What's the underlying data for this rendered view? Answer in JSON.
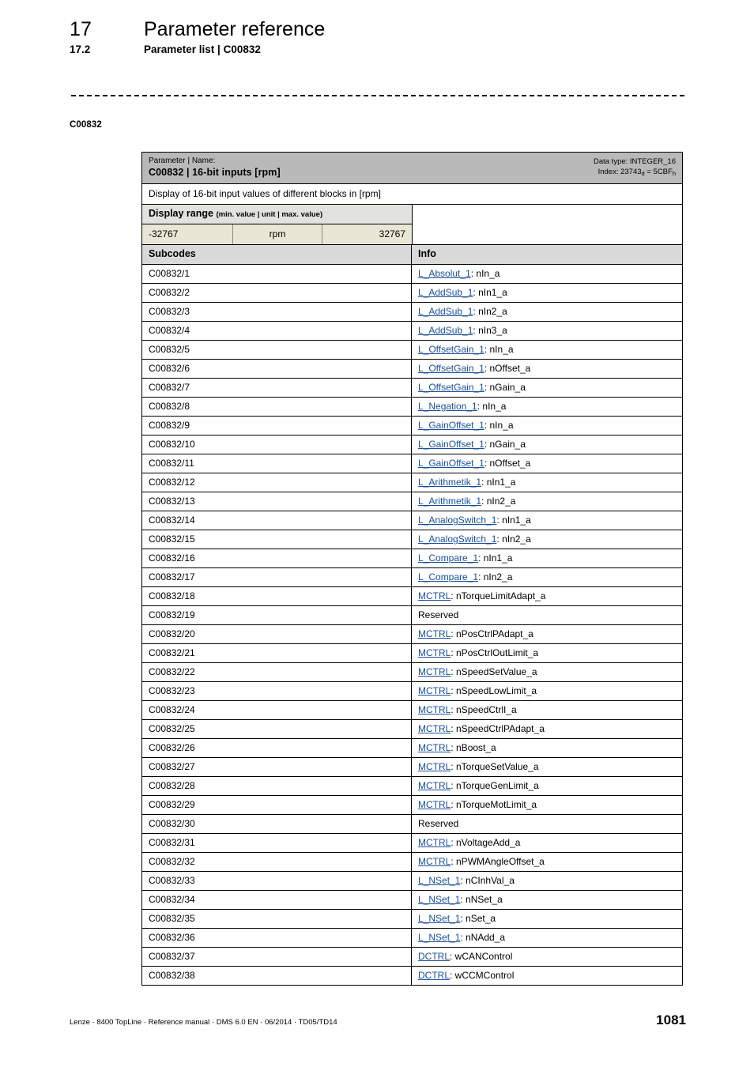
{
  "header": {
    "chapter_number": "17",
    "chapter_title": "Parameter reference",
    "section_number": "17.2",
    "section_title": "Parameter list | C00832"
  },
  "margin_label": "C00832",
  "parameter": {
    "kicker": "Parameter | Name:",
    "name": "C00832 | 16-bit inputs [rpm]",
    "data_type_label": "Data type: INTEGER_16",
    "index_prefix": "Index: 23743",
    "index_dec_sub": "d",
    "index_equals": " = 5CBF",
    "index_hex_sub": "h",
    "description": "Display of 16-bit input values of different blocks in [rpm]",
    "display_range": {
      "title": "Display range ",
      "note": "(min. value | unit | max. value)",
      "min": "-32767",
      "unit": "rpm",
      "max": "32767"
    },
    "columns": {
      "subcodes": "Subcodes",
      "info": "Info"
    },
    "rows": [
      {
        "subcode": "C00832/1",
        "link": "L_Absolut_1",
        "signal": ": nIn_a"
      },
      {
        "subcode": "C00832/2",
        "link": "L_AddSub_1",
        "signal": ": nIn1_a"
      },
      {
        "subcode": "C00832/3",
        "link": "L_AddSub_1",
        "signal": ": nIn2_a"
      },
      {
        "subcode": "C00832/4",
        "link": "L_AddSub_1",
        "signal": ": nIn3_a"
      },
      {
        "subcode": "C00832/5",
        "link": "L_OffsetGain_1",
        "signal": ": nIn_a"
      },
      {
        "subcode": "C00832/6",
        "link": "L_OffsetGain_1",
        "signal": ": nOffset_a"
      },
      {
        "subcode": "C00832/7",
        "link": "L_OffsetGain_1",
        "signal": ": nGain_a"
      },
      {
        "subcode": "C00832/8",
        "link": "L_Negation_1",
        "signal": ": nIn_a"
      },
      {
        "subcode": "C00832/9",
        "link": "L_GainOffset_1",
        "signal": ": nIn_a"
      },
      {
        "subcode": "C00832/10",
        "link": "L_GainOffset_1",
        "signal": ": nGain_a"
      },
      {
        "subcode": "C00832/11",
        "link": "L_GainOffset_1",
        "signal": ": nOffset_a"
      },
      {
        "subcode": "C00832/12",
        "link": "L_Arithmetik_1",
        "signal": ": nIn1_a"
      },
      {
        "subcode": "C00832/13",
        "link": "L_Arithmetik_1",
        "signal": ": nIn2_a"
      },
      {
        "subcode": "C00832/14",
        "link": "L_AnalogSwitch_1",
        "signal": ": nIn1_a"
      },
      {
        "subcode": "C00832/15",
        "link": "L_AnalogSwitch_1",
        "signal": ": nIn2_a"
      },
      {
        "subcode": "C00832/16",
        "link": "L_Compare_1",
        "signal": ": nIn1_a"
      },
      {
        "subcode": "C00832/17",
        "link": "L_Compare_1",
        "signal": ": nIn2_a"
      },
      {
        "subcode": "C00832/18",
        "link": "MCTRL",
        "signal": ": nTorqueLimitAdapt_a"
      },
      {
        "subcode": "C00832/19",
        "link": "",
        "signal": "Reserved"
      },
      {
        "subcode": "C00832/20",
        "link": "MCTRL",
        "signal": ": nPosCtrlPAdapt_a"
      },
      {
        "subcode": "C00832/21",
        "link": "MCTRL",
        "signal": ": nPosCtrlOutLimit_a"
      },
      {
        "subcode": "C00832/22",
        "link": "MCTRL",
        "signal": ": nSpeedSetValue_a"
      },
      {
        "subcode": "C00832/23",
        "link": "MCTRL",
        "signal": ": nSpeedLowLimit_a"
      },
      {
        "subcode": "C00832/24",
        "link": "MCTRL",
        "signal": ": nSpeedCtrlI_a"
      },
      {
        "subcode": "C00832/25",
        "link": "MCTRL",
        "signal": ": nSpeedCtrlPAdapt_a"
      },
      {
        "subcode": "C00832/26",
        "link": "MCTRL",
        "signal": ": nBoost_a"
      },
      {
        "subcode": "C00832/27",
        "link": "MCTRL",
        "signal": ": nTorqueSetValue_a"
      },
      {
        "subcode": "C00832/28",
        "link": "MCTRL",
        "signal": ": nTorqueGenLimit_a"
      },
      {
        "subcode": "C00832/29",
        "link": "MCTRL",
        "signal": ": nTorqueMotLimit_a"
      },
      {
        "subcode": "C00832/30",
        "link": "",
        "signal": "Reserved"
      },
      {
        "subcode": "C00832/31",
        "link": "MCTRL",
        "signal": ": nVoltageAdd_a"
      },
      {
        "subcode": "C00832/32",
        "link": "MCTRL",
        "signal": ": nPWMAngleOffset_a"
      },
      {
        "subcode": "C00832/33",
        "link": "L_NSet_1",
        "signal": ": nCInhVal_a"
      },
      {
        "subcode": "C00832/34",
        "link": "L_NSet_1",
        "signal": ": nNSet_a"
      },
      {
        "subcode": "C00832/35",
        "link": "L_NSet_1",
        "signal": ": nSet_a"
      },
      {
        "subcode": "C00832/36",
        "link": "L_NSet_1",
        "signal": ": nNAdd_a"
      },
      {
        "subcode": "C00832/37",
        "link": "DCTRL",
        "signal": ": wCANControl"
      },
      {
        "subcode": "C00832/38",
        "link": "DCTRL",
        "signal": ": wCCMControl"
      }
    ]
  },
  "footer": {
    "text": "Lenze · 8400 TopLine · Reference manual · DMS 6.0 EN · 06/2014 · TD05/TD14",
    "page_number": "1081"
  },
  "colors": {
    "title_band": "#b9b9b9",
    "subheader_band": "#d9d9d9",
    "range_header_band": "#e2e2df",
    "range_value_band": "#e9e6d6",
    "link": "#1a4f9c"
  }
}
